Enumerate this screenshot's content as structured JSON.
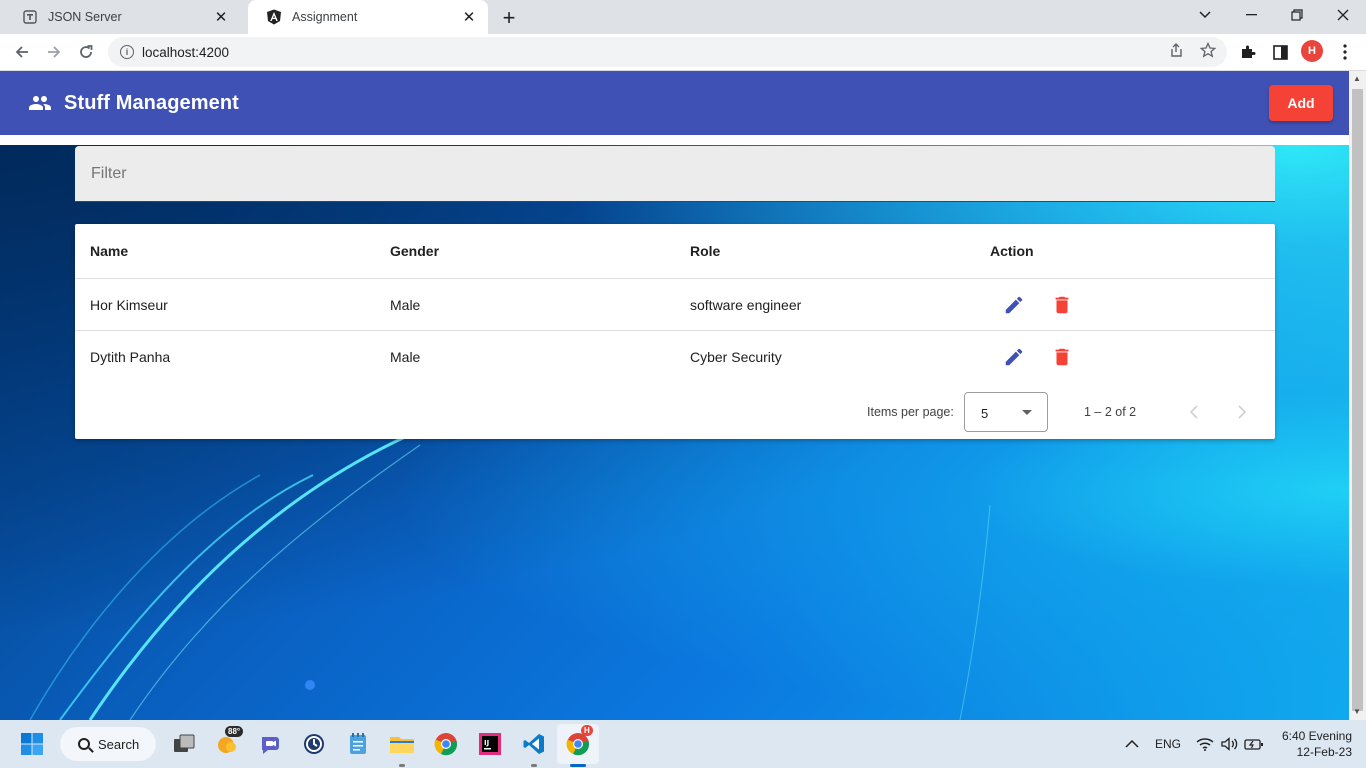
{
  "browser": {
    "tabs": [
      {
        "title": "JSON Server",
        "active": false
      },
      {
        "title": "Assignment",
        "active": true
      }
    ],
    "url": "localhost:4200",
    "profile_initial": "H"
  },
  "app": {
    "title": "Stuff Management",
    "add_label": "Add",
    "filter_placeholder": "Filter",
    "colors": {
      "primary": "#3f51b5",
      "warn": "#f44336"
    }
  },
  "table": {
    "columns": [
      "Name",
      "Gender",
      "Role",
      "Action"
    ],
    "rows": [
      {
        "name": "Hor Kimseur",
        "gender": "Male",
        "role": "software engineer"
      },
      {
        "name": "Dytith Panha",
        "gender": "Male",
        "role": "Cyber Security"
      }
    ]
  },
  "paginator": {
    "label": "Items per page:",
    "page_size": "5",
    "range": "1 – 2 of 2"
  },
  "taskbar": {
    "search_label": "Search",
    "weather_temp": "88°",
    "chrome_badge": "H",
    "language": "ENG",
    "time": "6:40 Evening",
    "date": "12-Feb-23"
  }
}
